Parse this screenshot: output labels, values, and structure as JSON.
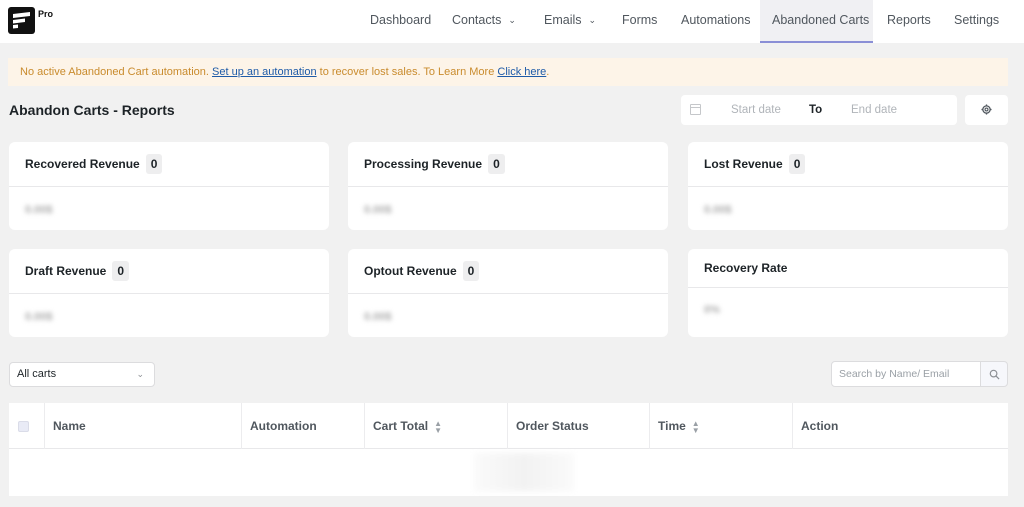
{
  "brand": {
    "badge": "Pro"
  },
  "nav": {
    "items": [
      {
        "label": "Dashboard"
      },
      {
        "label": "Contacts"
      },
      {
        "label": "Emails"
      },
      {
        "label": "Forms"
      },
      {
        "label": "Automations"
      },
      {
        "label": "Abandoned Carts"
      },
      {
        "label": "Reports"
      },
      {
        "label": "Settings"
      }
    ],
    "active": "Abandoned Carts"
  },
  "notice": {
    "prefix": "No active Abandoned Cart automation. ",
    "link1": "Set up an automation",
    "middle": " to recover lost sales. To Learn More ",
    "link2": "Click here",
    "suffix": "."
  },
  "header": {
    "title": "Abandon Carts - Reports",
    "start_placeholder": "Start date",
    "to_label": "To",
    "end_placeholder": "End date"
  },
  "cards": [
    {
      "title": "Recovered Revenue",
      "count": "0",
      "value": "0.00$"
    },
    {
      "title": "Processing Revenue",
      "count": "0",
      "value": "0.00$"
    },
    {
      "title": "Lost Revenue",
      "count": "0",
      "value": "0.00$"
    },
    {
      "title": "Draft Revenue",
      "count": "0",
      "value": "0.00$"
    },
    {
      "title": "Optout Revenue",
      "count": "0",
      "value": "0.00$"
    },
    {
      "title": "Recovery Rate",
      "value": "0%"
    }
  ],
  "filter": {
    "selected": "All carts"
  },
  "search": {
    "placeholder": "Search by Name/ Email"
  },
  "table": {
    "columns": [
      "Name",
      "Automation",
      "Cart Total",
      "Order Status",
      "Time",
      "Action"
    ]
  },
  "colors": {
    "accent": "#8a8fd6",
    "notice_bg": "#fdf4e8",
    "notice_text": "#c98b2d",
    "link": "#1e5ba8"
  }
}
